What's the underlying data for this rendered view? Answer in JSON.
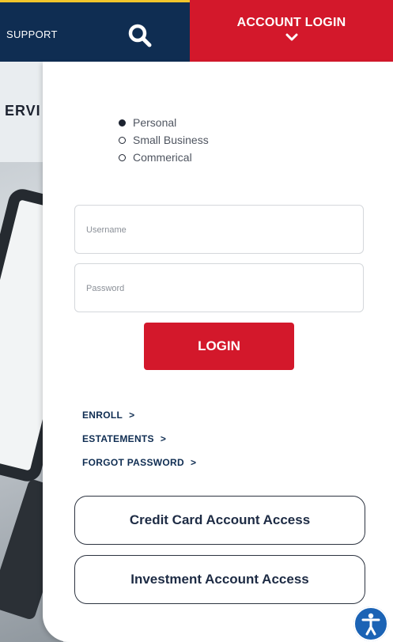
{
  "header": {
    "support_label": "SUPPORT",
    "search_icon": "search-icon",
    "account_login_label": "ACCOUNT LOGIN",
    "account_chevron_icon": "chevron-down-icon"
  },
  "background": {
    "heading_fragment": "ERVI"
  },
  "login": {
    "account_types": [
      {
        "label": "Personal",
        "selected": true
      },
      {
        "label": "Small Business",
        "selected": false
      },
      {
        "label": "Commerical",
        "selected": false
      }
    ],
    "username_placeholder": "Username",
    "password_placeholder": "Password",
    "login_button": "LOGIN",
    "links": [
      {
        "label": "ENROLL",
        "arrow": ">"
      },
      {
        "label": "ESTATEMENTS",
        "arrow": ">"
      },
      {
        "label": "FORGOT PASSWORD",
        "arrow": ">"
      }
    ],
    "credit_card_button": "Credit Card Account Access",
    "investment_button": "Investment Account Access"
  },
  "accessibility_icon": "accessibility-icon",
  "colors": {
    "navy": "#0f2d52",
    "brand_red": "#d3182b",
    "gold": "#f1c52b",
    "a11y_blue": "#1b63b5"
  }
}
